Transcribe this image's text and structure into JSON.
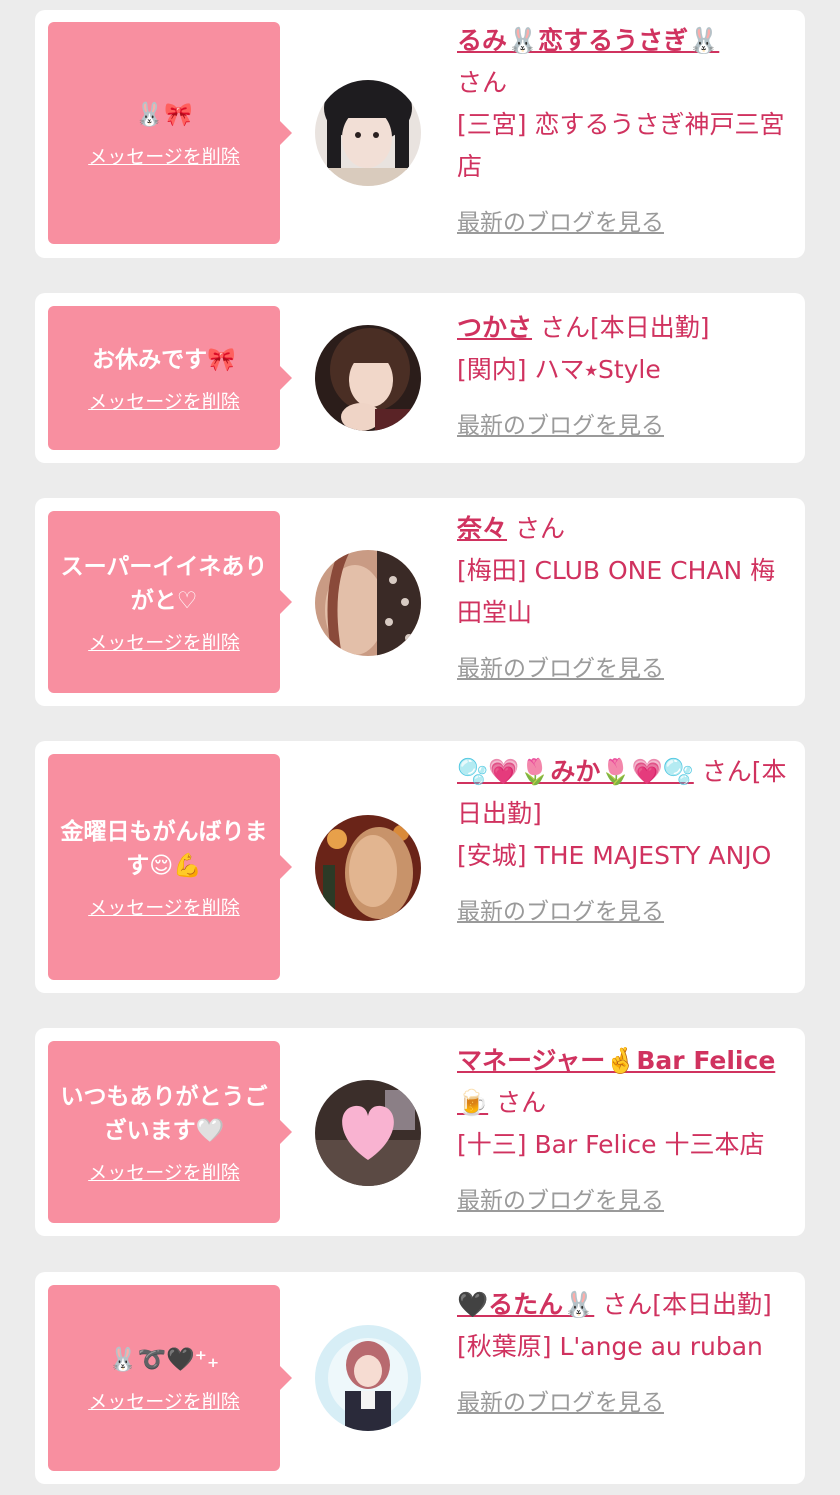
{
  "cards": [
    {
      "message": "🐰🎀",
      "delete_label": "メッセージを削除",
      "name": "るみ🐰恋するうさぎ🐰",
      "honorific": "さん",
      "status": "",
      "shop": "[三宮] 恋するうさぎ神戸三宮店",
      "blog_label": "最新のブログを見る",
      "avatar_icon": "girl-portrait-photo"
    },
    {
      "message": "お休みです🎀",
      "delete_label": "メッセージを削除",
      "name": "つかさ",
      "honorific": "さん",
      "status": "[本日出勤]",
      "shop": "[関内] ハマ⭑Style",
      "blog_label": "最新のブログを見る",
      "avatar_icon": "girl-portrait-photo"
    },
    {
      "message": "スーパーイイネありがと♡",
      "delete_label": "メッセージを削除",
      "name": "奈々",
      "honorific": "さん",
      "status": "",
      "shop": "[梅田] CLUB ONE CHAN 梅田堂山",
      "blog_label": "最新のブログを見る",
      "avatar_icon": "girl-portrait-photo"
    },
    {
      "message": "金曜日もがんばります😌💪",
      "delete_label": "メッセージを削除",
      "name": "🫧💗🌷みか🌷💗🫧",
      "honorific": "さん",
      "status": "[本日出勤]",
      "shop": "[安城] THE MAJESTY ANJO",
      "blog_label": "最新のブログを見る",
      "avatar_icon": "girl-portrait-photo"
    },
    {
      "message": "いつもありがとうございます🤍",
      "delete_label": "メッセージを削除",
      "name": "マネージャー🤞Bar Felice🍺",
      "honorific": "さん",
      "status": "",
      "shop": "[十三] Bar Felice 十三本店",
      "blog_label": "最新のブログを見る",
      "avatar_icon": "heart-covered-photo"
    },
    {
      "message": "🐰➰🖤⁺₊",
      "delete_label": "メッセージを削除",
      "name": "🖤るたん🐰",
      "honorific": "さん",
      "status": "[本日出勤]",
      "shop": "[秋葉原] L'ange au ruban",
      "blog_label": "最新のブログを見る",
      "avatar_icon": "girl-portrait-photo"
    }
  ],
  "colors": {
    "accent": "#d0325f",
    "bubble": "#f88fa0",
    "background": "#ececec",
    "muted_link": "#9a9a9a"
  }
}
